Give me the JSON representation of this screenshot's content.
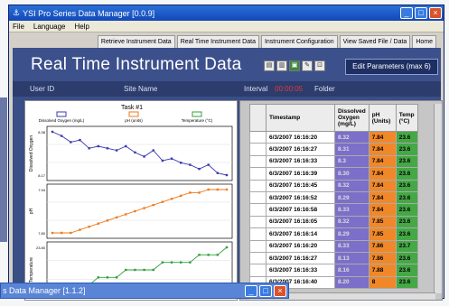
{
  "window": {
    "title": "YSI Pro Series Data Manager  [0.0.9]",
    "controls": [
      "_",
      "□",
      "×"
    ]
  },
  "menu": [
    "File",
    "Language",
    "Help"
  ],
  "tabs": [
    "Retrieve Instrument Data",
    "Real Time Instrument Data",
    "Instrument Configuration",
    "View Saved File / Data",
    "Home"
  ],
  "header": {
    "title": "Real Time Instrument Data",
    "edit_button": "Edit Parameters (max 6)"
  },
  "infobar": {
    "user_id": "User ID",
    "site_name": "Site Name",
    "interval_label": "Interval",
    "interval_value": "00:00:05",
    "folder": "Folder"
  },
  "chart_data": {
    "type": "line",
    "title": "Task #1",
    "series": [
      {
        "name": "Dissolved Oxygen (mg/L)",
        "color": "#3a3ab0",
        "values": [
          8.38,
          8.36,
          8.33,
          8.34,
          8.3,
          8.31,
          8.3,
          8.29,
          8.31,
          8.28,
          8.26,
          8.29,
          8.24,
          8.25,
          8.23,
          8.22,
          8.2,
          8.22,
          8.18,
          8.17
        ]
      },
      {
        "name": "pH (units)",
        "color": "#f07a1a",
        "values": [
          7.8,
          7.8,
          7.8,
          7.81,
          7.82,
          7.83,
          7.84,
          7.85,
          7.86,
          7.87,
          7.88,
          7.89,
          7.9,
          7.91,
          7.92,
          7.93,
          7.93,
          7.94,
          7.94,
          7.94
        ]
      },
      {
        "name": "Temperature (°C)",
        "color": "#2fa03a",
        "values": [
          23.2,
          23.2,
          23.3,
          23.3,
          23.3,
          23.4,
          23.4,
          23.4,
          23.5,
          23.5,
          23.5,
          23.5,
          23.6,
          23.6,
          23.6,
          23.6,
          23.7,
          23.7,
          23.7,
          23.8
        ]
      }
    ],
    "y_labels": [
      "Dissolved Oxygen",
      "pH",
      "Temperature"
    ]
  },
  "grid": {
    "headers": [
      "Timestamp",
      "Dissolved Oxygen (mg/L)",
      "pH (Units)",
      "Temp (°C)"
    ],
    "rows": [
      [
        "6/3/2007 16:16:20",
        "8.32",
        "7.84",
        "23.6"
      ],
      [
        "6/3/2007 16:16:27",
        "8.31",
        "7.84",
        "23.6"
      ],
      [
        "6/3/2007 16:16:33",
        "8.3",
        "7.84",
        "23.6"
      ],
      [
        "6/3/2007 16:16:39",
        "8.30",
        "7.84",
        "23.6"
      ],
      [
        "6/3/2007 16:16:45",
        "8.32",
        "7.84",
        "23.6"
      ],
      [
        "6/3/2007 16:16:52",
        "8.29",
        "7.84",
        "23.6"
      ],
      [
        "6/3/2007 16:16:58",
        "8.33",
        "7.84",
        "23.6"
      ],
      [
        "6/3/2007 16:16:05",
        "8.32",
        "7.85",
        "23.6"
      ],
      [
        "6/3/2007 16:16:14",
        "8.29",
        "7.85",
        "23.6"
      ],
      [
        "6/3/2007 16:16:20",
        "8.33",
        "7.86",
        "23.7"
      ],
      [
        "6/3/2007 16:16:27",
        "8.13",
        "7.86",
        "23.6"
      ],
      [
        "6/3/2007 16:16:33",
        "8.16",
        "7.88",
        "23.6"
      ],
      [
        "6/3/2007 16:16:40",
        "8.20",
        "8",
        "23.6"
      ]
    ]
  },
  "taskbar": {
    "title": "s Data Manager  [1.1.2]"
  }
}
